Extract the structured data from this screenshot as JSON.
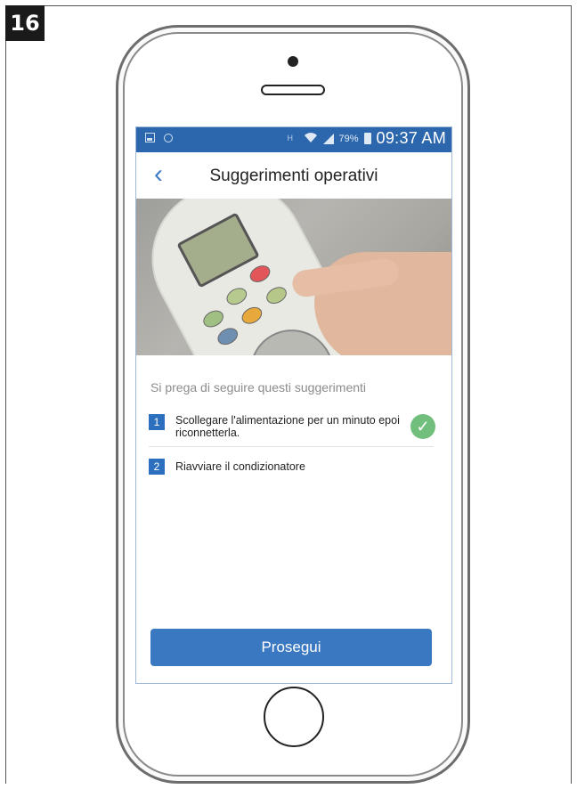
{
  "figure": {
    "step_number": "16"
  },
  "statusbar": {
    "network_label": "H",
    "battery_percent": "79%",
    "time": "09:37 AM"
  },
  "navbar": {
    "back_glyph": "‹",
    "title": "Suggerimenti operativi"
  },
  "hero": {
    "caption": "Si prega di seguire questi suggerimenti"
  },
  "steps": [
    {
      "number": "1",
      "text": "Scollegare l'alimentazione per un minuto epoi riconnetterla.",
      "completed": true
    },
    {
      "number": "2",
      "text": "Riavviare il condizionatore",
      "completed": false
    }
  ],
  "actions": {
    "continue_label": "Prosegui"
  },
  "colors": {
    "statusbar": "#2c67ad",
    "accent": "#3a78c2",
    "check": "#72bf7d"
  },
  "icons": {
    "back": "chevron-left-icon",
    "check": "checkmark-circle-icon",
    "wifi": "wifi-icon",
    "signal": "signal-icon",
    "battery": "battery-icon"
  }
}
